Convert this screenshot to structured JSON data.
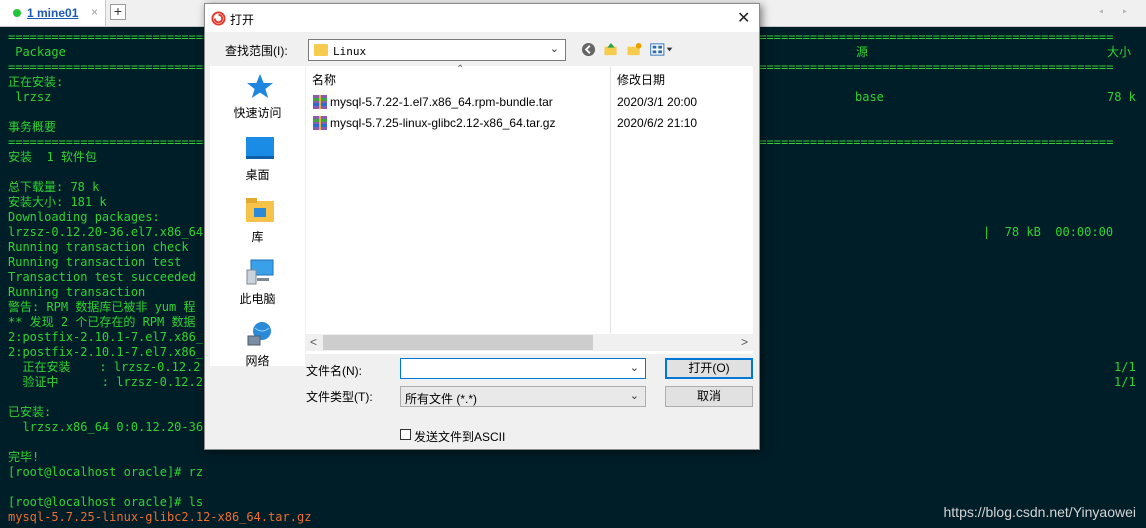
{
  "tabbar": {
    "tab_label": "1 mine01",
    "close_glyph": "×",
    "new_tab_glyph": "+",
    "nav_glyphs": "◂ ▸"
  },
  "terminal": {
    "lines": [
      "=========================================================================================================================================================",
      " Package",
      "=========================================================================================================================================================",
      "正在安装:",
      " lrzsz",
      "",
      "事务概要",
      "=========================================================================================================================================================",
      "安装  1 软件包",
      "",
      "总下载量: 78 k",
      "安装大小: 181 k",
      "Downloading packages:",
      "lrzsz-0.12.20-36.el7.x86_64.",
      "Running transaction check",
      "Running transaction test",
      "Transaction test succeeded",
      "Running transaction",
      "警告: RPM 数据库已被非 yum 程",
      "** 发现 2 个已存在的 RPM 数据",
      "2:postfix-2.10.1-7.el7.x86_6",
      "2:postfix-2.10.1-7.el7.x86_6",
      "  正在安装    : lrzsz-0.12.2",
      "  验证中      : lrzsz-0.12.2",
      "",
      "已安装:",
      "  lrzsz.x86_64 0:0.12.20-36.",
      "",
      "完毕!",
      "[root@localhost oracle]# rz",
      "",
      "[root@localhost oracle]# ls",
      "mysql-5.7.25-linux-glibc2.12-x86_64.tar.gz"
    ],
    "col_repo_header": "源",
    "col_size_header": "大小",
    "repo_value": "base",
    "size_value": "78 k",
    "download_progress": "|  78 kB  00:00:00",
    "step_install_count": "1/1",
    "step_verify_count": "1/1"
  },
  "watermark": "https://blog.csdn.net/Yinyaowei",
  "dialog": {
    "title": "打开",
    "close_glyph": "✕",
    "lookin_label": "查找范围(I):",
    "lookin_value": "Linux",
    "places": [
      {
        "label": "快速访问"
      },
      {
        "label": "桌面"
      },
      {
        "label": "库"
      },
      {
        "label": "此电脑"
      },
      {
        "label": "网络"
      }
    ],
    "columns": {
      "name": "名称",
      "modified": "修改日期"
    },
    "files": [
      {
        "name": "mysql-5.7.22-1.el7.x86_64.rpm-bundle.tar",
        "modified": "2020/3/1 20:00"
      },
      {
        "name": "mysql-5.7.25-linux-glibc2.12-x86_64.tar.gz",
        "modified": "2020/6/2 21:10"
      }
    ],
    "filename_label": "文件名(N):",
    "filename_value": "",
    "filetype_label": "文件类型(T):",
    "filetype_value": "所有文件 (*.*)",
    "open_button": "打开(O)",
    "cancel_button": "取消",
    "ascii_label": "发送文件到ASCII",
    "ascii_checked": false
  }
}
